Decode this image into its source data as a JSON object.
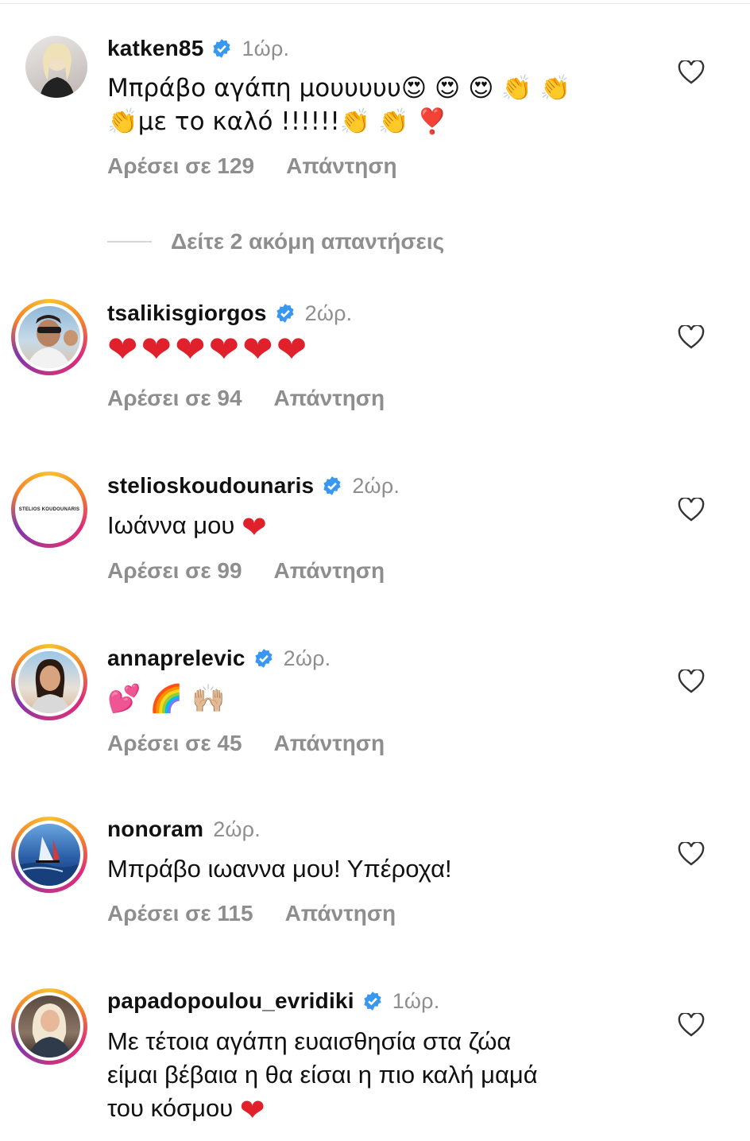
{
  "comments": [
    {
      "user": "katken85",
      "verified": true,
      "time": "1ώρ.",
      "text_line1": "Μπράβο αγάπη μουυυυυ😍 😍 😍 👏 👏",
      "text_line2": "👏με το καλό !!!!!!👏 👏 ❣️",
      "likes": "Αρέσει σε 129",
      "reply": "Απάντηση"
    },
    {
      "user": "tsalikisgiorgos",
      "verified": true,
      "time": "2ώρ.",
      "text": "❤❤❤❤❤❤",
      "likes": "Αρέσει σε 94",
      "reply": "Απάντηση"
    },
    {
      "user": "stelioskoudounaris",
      "verified": true,
      "time": "2ώρ.",
      "text": "Ιωάννα μου",
      "likes": "Αρέσει σε 99",
      "reply": "Απάντηση",
      "avatar_text": "STELIOS KOUDOUNARIS"
    },
    {
      "user": "annaprelevic",
      "verified": true,
      "time": "2ώρ.",
      "text": "💕 🌈 🙌🏼",
      "likes": "Αρέσει σε 45",
      "reply": "Απάντηση"
    },
    {
      "user": "nonoram",
      "verified": false,
      "time": "2ώρ.",
      "text": "Μπράβο ιωαννα μου! Υπέροχα!",
      "likes": "Αρέσει σε 115",
      "reply": "Απάντηση"
    },
    {
      "user": "papadopoulou_evridiki",
      "verified": true,
      "time": "1ώρ.",
      "text_line1": "Με τέτοια αγάπη ευαισθησία στα ζώα",
      "text_line2": "είμαι βέβαια η θα είσαι η πιο καλή μαμά",
      "text_line3": "του κόσμου"
    }
  ],
  "view_replies": "Δείτε 2 ακόμη απαντήσεις",
  "colors": {
    "verified": "#3897f0",
    "meta": "#8e8e8e",
    "heart_red": "#e0202a"
  }
}
